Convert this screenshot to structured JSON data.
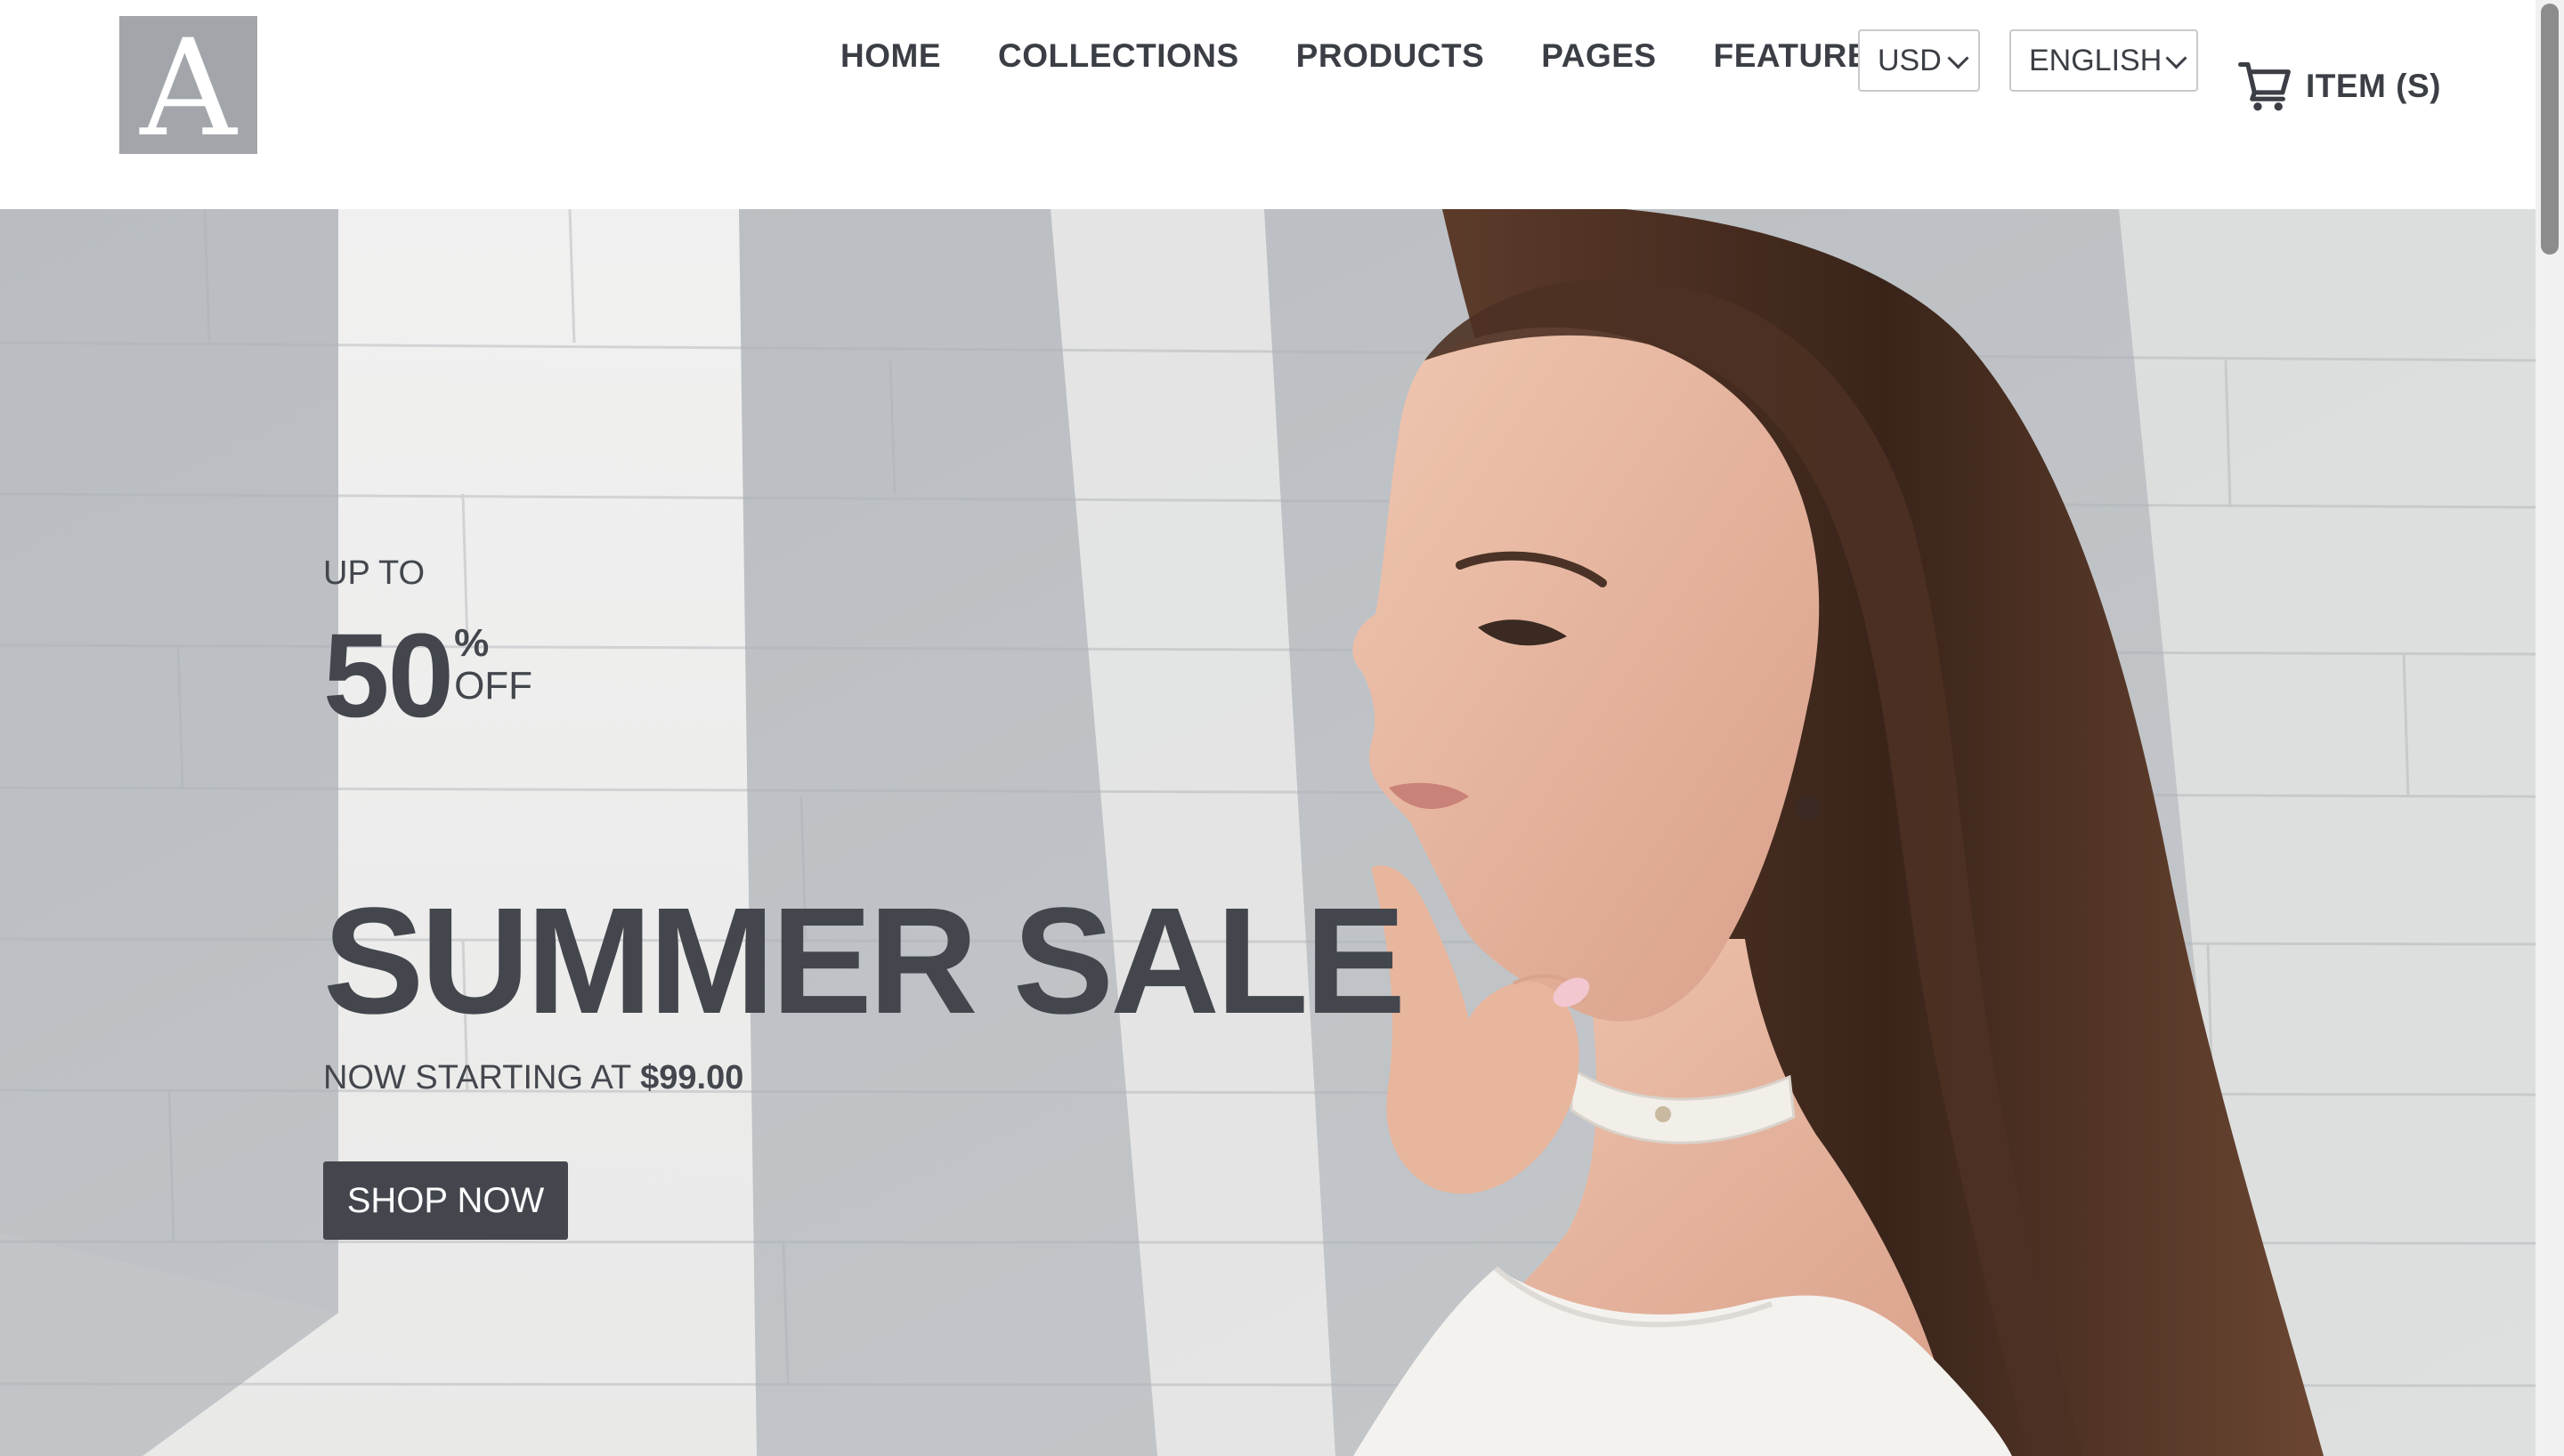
{
  "header": {
    "logo_letter": "A",
    "nav": [
      "HOME",
      "COLLECTIONS",
      "PRODUCTS",
      "PAGES",
      "FEATURES"
    ],
    "currency": {
      "selected": "USD"
    },
    "language": {
      "selected": "ENGLISH"
    },
    "cart": {
      "label": "ITEM (S)",
      "icon": "cart-icon"
    }
  },
  "hero": {
    "up_to": "UP TO",
    "discount_value": "50",
    "discount_percent": "%",
    "discount_off": "OFF",
    "headline": "SUMMER SALE",
    "price_prefix": "NOW STARTING AT",
    "price": "$99.00",
    "cta": "SHOP NOW",
    "image": "woman-profile-photo"
  },
  "colors": {
    "text_dark": "#43474d",
    "logo_bg": "#a2a6aa",
    "button_bg": "#43474d",
    "hair": "#4a2f22",
    "skin": "#e6b59e"
  }
}
